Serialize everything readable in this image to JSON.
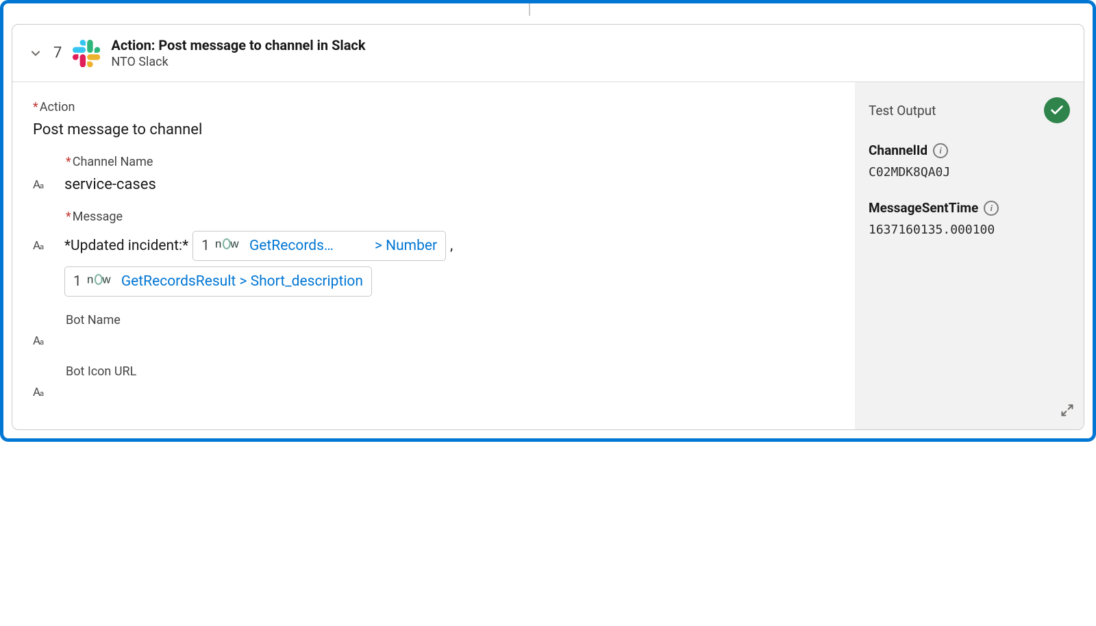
{
  "step": {
    "number": "7",
    "title": "Action: Post message to channel in Slack",
    "subtitle": "NTO Slack"
  },
  "fields": {
    "action": {
      "label": "Action",
      "value": "Post message to channel"
    },
    "channelName": {
      "label": "Channel Name",
      "value": "service-cases"
    },
    "message": {
      "label": "Message",
      "prefix": "*Updated incident:*",
      "pill1": {
        "srcNum": "1",
        "textHead": "GetRecords…",
        "textTail": "> Number"
      },
      "sep": ",",
      "pill2": {
        "srcNum": "1",
        "text": "GetRecordsResult > Short_description"
      }
    },
    "botName": {
      "label": "Bot Name"
    },
    "botIconUrl": {
      "label": "Bot Icon URL"
    }
  },
  "output": {
    "title": "Test Output",
    "channelId": {
      "label": "ChannelId",
      "value": "C02MDK8QA0J"
    },
    "messageSentTime": {
      "label": "MessageSentTime",
      "value": "1637160135.000100"
    }
  }
}
